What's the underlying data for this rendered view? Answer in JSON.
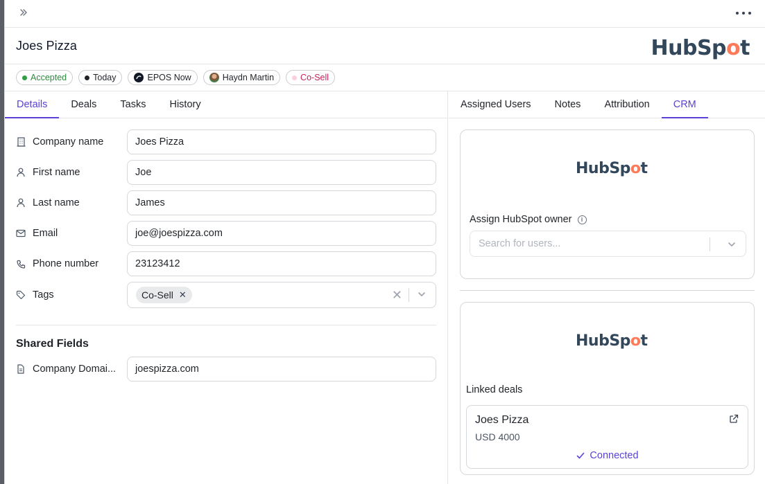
{
  "record": {
    "title": "Joes Pizza",
    "crm_logo_text": "HubSpot"
  },
  "chips": [
    {
      "label": "Accepted",
      "dot_color": "#2f9e44",
      "border": "#c9ccd1"
    },
    {
      "label": "Today",
      "dot_color": "#1f2328"
    },
    {
      "label": "EPOS Now",
      "icon": "epos-logo-icon"
    },
    {
      "label": "Haydn Martin",
      "icon": "avatar"
    },
    {
      "label": "Co-Sell",
      "dot_color": "#fbd0dd",
      "text_color": "#c2255c"
    }
  ],
  "left_tabs": [
    {
      "label": "Details",
      "active": true
    },
    {
      "label": "Deals",
      "active": false
    },
    {
      "label": "Tasks",
      "active": false
    },
    {
      "label": "History",
      "active": false
    }
  ],
  "right_tabs": [
    {
      "label": "Assigned Users",
      "active": false
    },
    {
      "label": "Notes",
      "active": false
    },
    {
      "label": "Attribution",
      "active": false
    },
    {
      "label": "CRM",
      "active": true
    }
  ],
  "fields": {
    "company_name": {
      "label": "Company name",
      "value": "Joes Pizza",
      "icon": "building-icon"
    },
    "first_name": {
      "label": "First name",
      "value": "Joe",
      "icon": "person-icon"
    },
    "last_name": {
      "label": "Last name",
      "value": "James",
      "icon": "person-icon"
    },
    "email": {
      "label": "Email",
      "value": "joe@joespizza.com",
      "icon": "mail-icon"
    },
    "phone": {
      "label": "Phone number",
      "value": "23123412",
      "icon": "phone-icon"
    },
    "tags": {
      "label": "Tags",
      "values": [
        "Co-Sell"
      ],
      "icon": "tag-icon"
    }
  },
  "shared": {
    "title": "Shared Fields",
    "company_domain": {
      "label": "Company Domai...",
      "value": "joespizza.com",
      "icon": "document-icon"
    }
  },
  "crm": {
    "logo_text": "HubSpot",
    "owner_label": "Assign HubSpot owner",
    "owner_placeholder": "Search for users...",
    "linked_label": "Linked deals",
    "deal": {
      "name": "Joes Pizza",
      "amount": "USD 4000",
      "status": "Connected"
    }
  },
  "colors": {
    "accent": "#5b3fd6",
    "hubspot_orange": "#ff7a59",
    "hubspot_navy": "#33475b"
  }
}
